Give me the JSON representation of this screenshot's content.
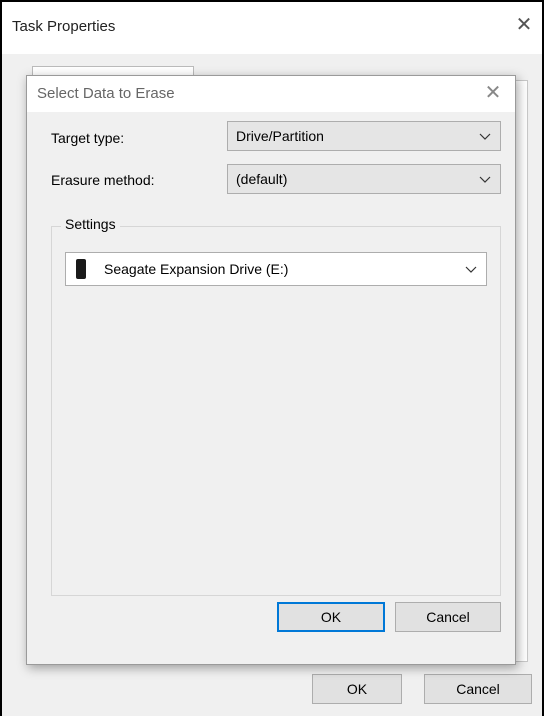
{
  "outer_window": {
    "title": "Task Properties",
    "ok_label": "OK",
    "cancel_label": "Cancel"
  },
  "dialog": {
    "title": "Select Data to Erase",
    "target_type_label": "Target type:",
    "target_type_value": "Drive/Partition",
    "erasure_method_label": "Erasure method:",
    "erasure_method_value": "(default)",
    "settings_label": "Settings",
    "drive_value": "Seagate Expansion Drive (E:)",
    "ok_label": "OK",
    "cancel_label": "Cancel"
  },
  "colors": {
    "focus_border": "#0078d7",
    "button_bg": "#e1e1e1",
    "window_bg": "#f0f0f0"
  }
}
